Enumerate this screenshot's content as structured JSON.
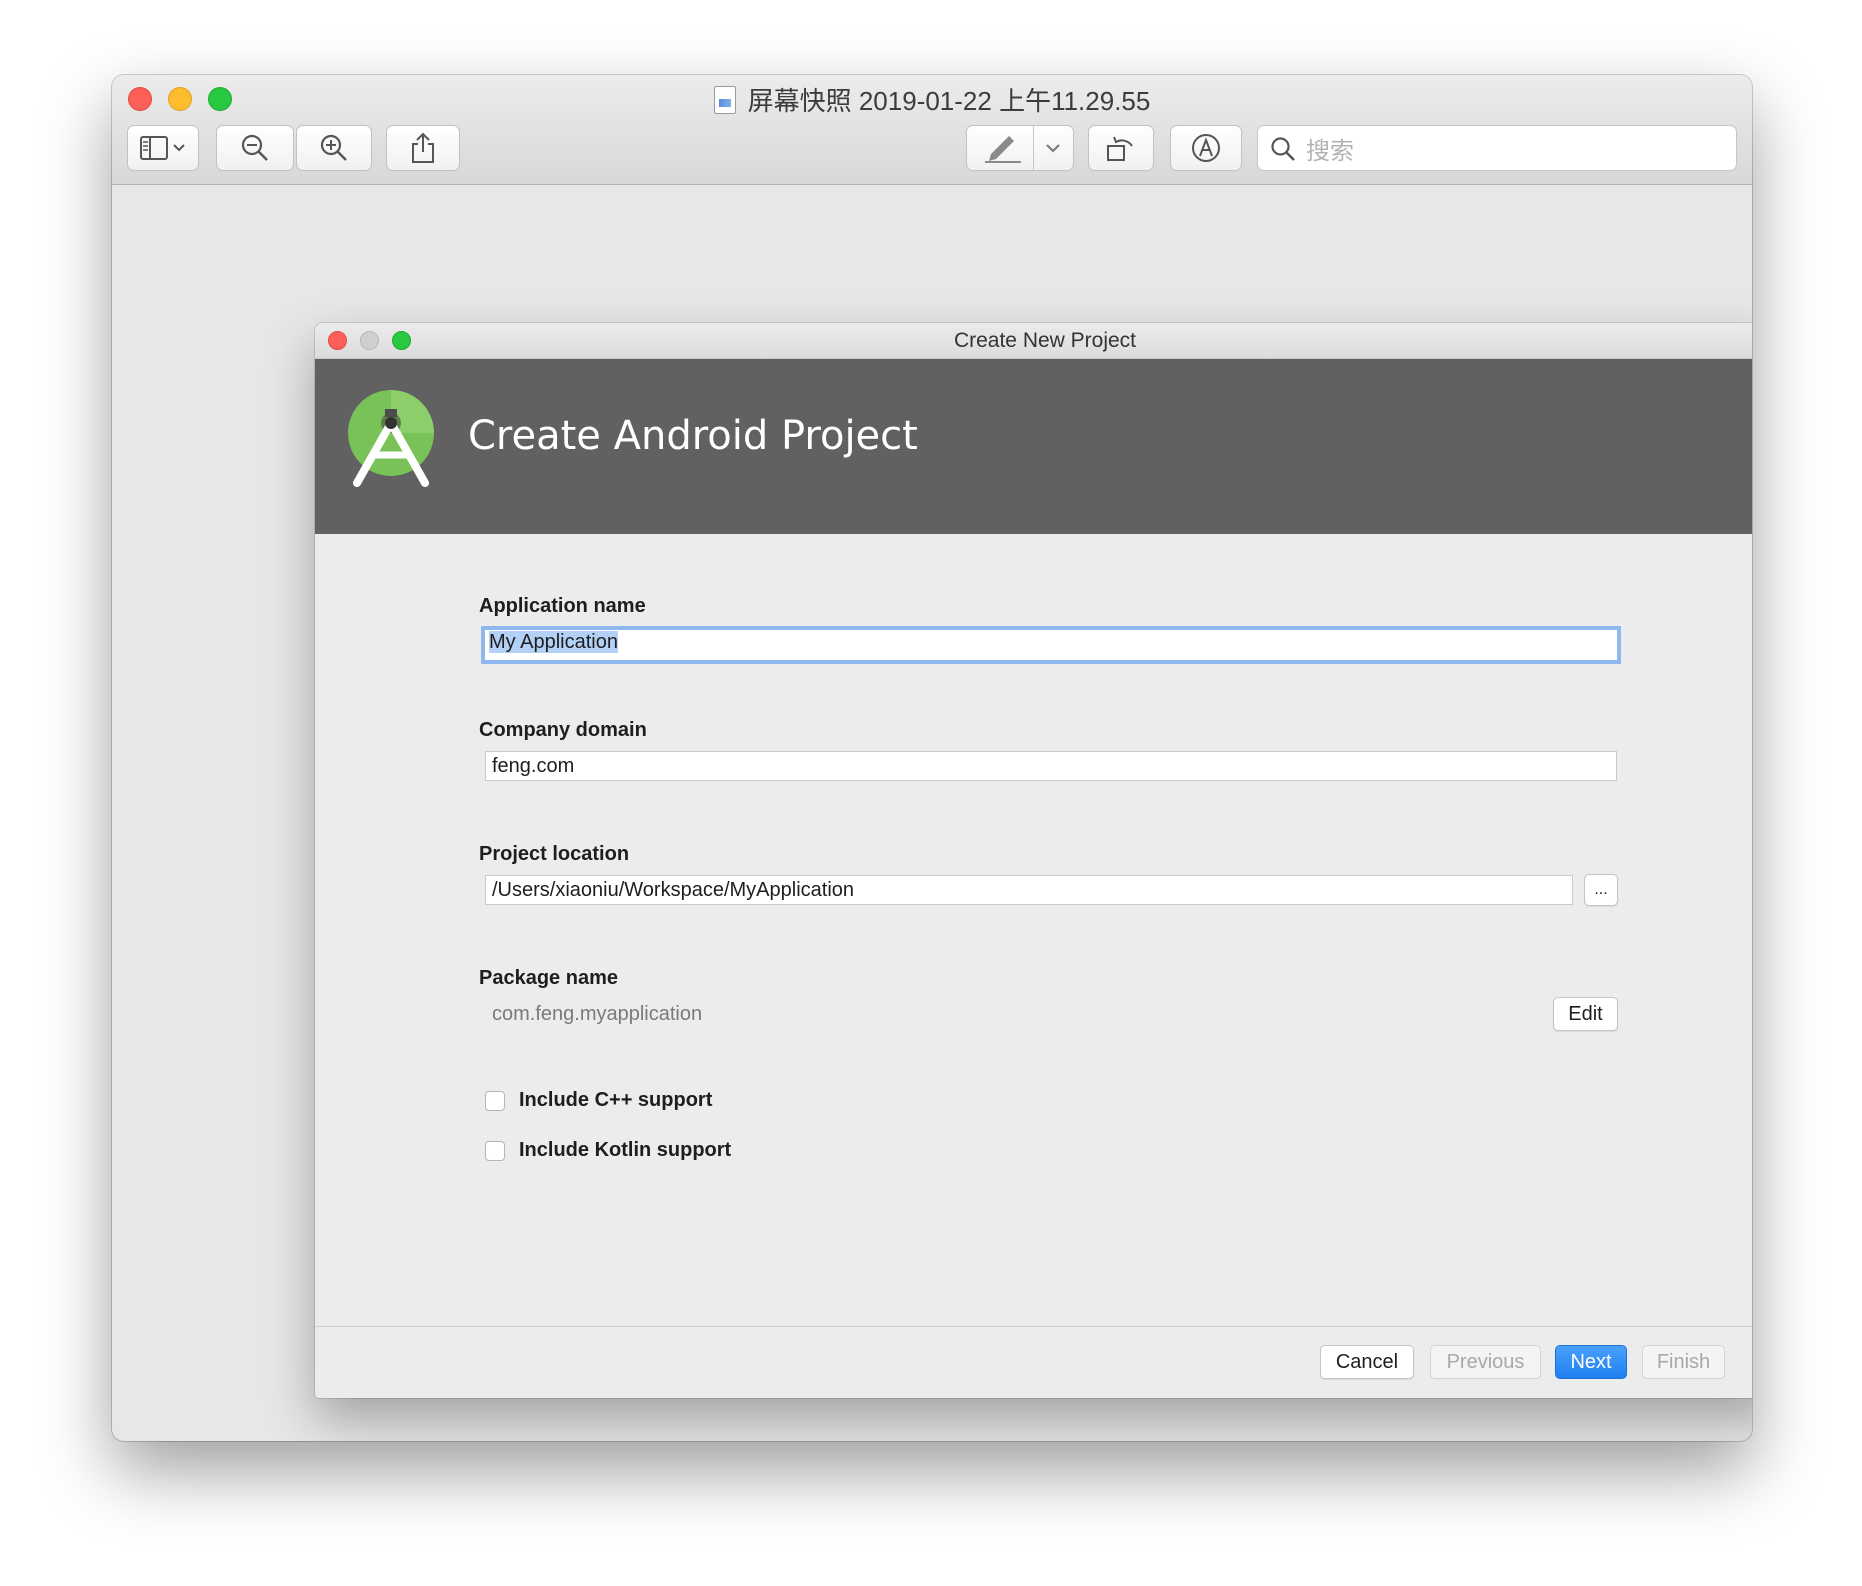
{
  "preview": {
    "title": "屏幕快照 2019-01-22 上午11.29.55",
    "search_placeholder": "搜索"
  },
  "dialog": {
    "window_title": "Create New Project",
    "header_title": "Create Android Project",
    "fields": {
      "app_name_label": "Application name",
      "app_name_value": "My Application",
      "company_domain_label": "Company domain",
      "company_domain_value": "feng.com",
      "project_location_label": "Project location",
      "project_location_value": "/Users/xiaoniu/Workspace/MyApplication",
      "browse_label": "...",
      "package_name_label": "Package name",
      "package_name_value": "com.feng.myapplication",
      "edit_label": "Edit"
    },
    "checkboxes": {
      "cpp_label": "Include C++ support",
      "kotlin_label": "Include Kotlin support"
    },
    "buttons": {
      "cancel": "Cancel",
      "previous": "Previous",
      "next": "Next",
      "finish": "Finish"
    }
  },
  "colors": {
    "banner": "#616161",
    "primary_button": "#2d8cf6",
    "android_green": "#78c257"
  }
}
